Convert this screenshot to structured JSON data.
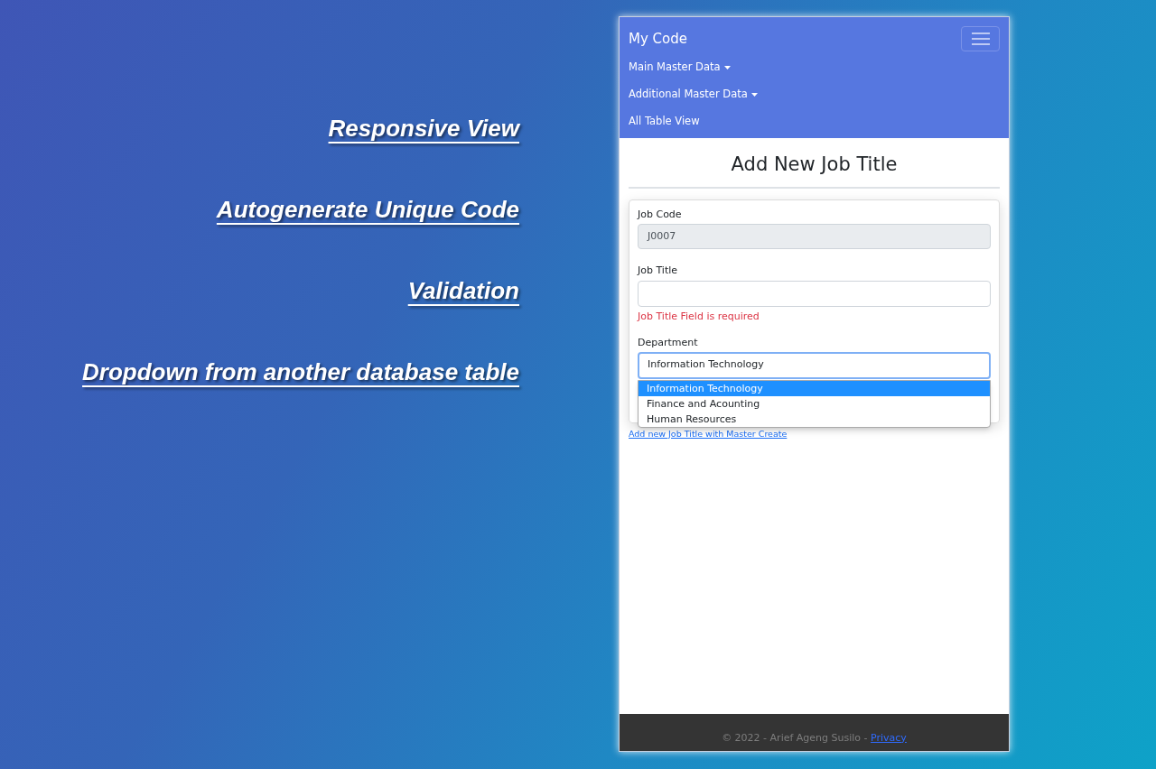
{
  "features": [
    "Responsive View",
    "Autogenerate Unique Code",
    "Validation",
    "Dropdown from another database table"
  ],
  "navbar": {
    "brand": "My Code",
    "items": [
      {
        "label": "Main Master Data",
        "dropdown": true
      },
      {
        "label": "Additional Master Data",
        "dropdown": true
      },
      {
        "label": "All Table View",
        "dropdown": false
      }
    ]
  },
  "page_title": "Add New Job Title",
  "form": {
    "job_code": {
      "label": "Job Code",
      "value": "J0007",
      "disabled": true
    },
    "job_title": {
      "label": "Job Title",
      "error": "Job Title Field is required"
    },
    "department": {
      "label": "Department",
      "value": "Information Technology",
      "expanded": true,
      "options": [
        {
          "label": "Information Technology",
          "selected": true
        },
        {
          "label": "Finance and Acounting",
          "selected": false
        },
        {
          "label": "Human Resources",
          "selected": false
        }
      ]
    }
  },
  "link": "Add new Job Title with Master Create",
  "footer": {
    "text": "© 2022 - Arief Ageng Susilo - ",
    "link": "Privacy"
  }
}
